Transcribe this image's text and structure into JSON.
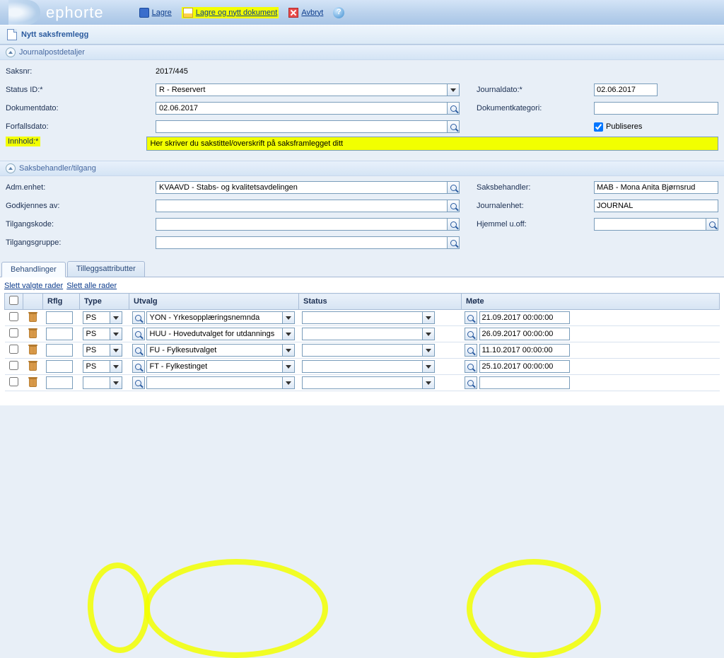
{
  "brand": "ephorte",
  "toolbar": {
    "save": "Lagre",
    "save_new": "Lagre og nytt dokument",
    "cancel": "Avbryt"
  },
  "page_title": "Nytt saksfremlegg",
  "sections": {
    "journal": "Journalpostdetaljer",
    "access": "Saksbehandler/tilgang"
  },
  "labels": {
    "saksnr": "Saksnr:",
    "status_id": "Status ID:*",
    "dokdato": "Dokumentdato:",
    "forfall": "Forfallsdato:",
    "innhold": "Innhold:*",
    "journaldato": "Journaldato:*",
    "dokkat": "Dokumentkategori:",
    "publiseres": "Publiseres",
    "admenhet": "Adm.enhet:",
    "godkjennes": "Godkjennes av:",
    "tilgangskode": "Tilgangskode:",
    "tilgangsgruppe": "Tilgangsgruppe:",
    "saksbehandler": "Saksbehandler:",
    "journalenhet": "Journalenhet:",
    "hjemmel": "Hjemmel u.off:"
  },
  "values": {
    "saksnr": "2017/445",
    "status_id": "R - Reservert",
    "dokdato": "02.06.2017",
    "forfall": "",
    "innhold": "Her skriver du sakstittel/overskrift på saksframlegget ditt",
    "journaldato": "02.06.2017",
    "dokkat": "",
    "publiseres": true,
    "admenhet": "KVAAVD - Stabs- og kvalitetsavdelingen",
    "godkjennes": "",
    "tilgangskode": "",
    "tilgangsgruppe": "",
    "saksbehandler": "MAB - Mona Anita Bjørnsrud",
    "journalenhet": "JOURNAL",
    "hjemmel": ""
  },
  "tabs": {
    "behandlinger": "Behandlinger",
    "tillegg": "Tilleggsattributter"
  },
  "grid": {
    "link_del_sel": "Slett valgte rader",
    "link_del_all": "Slett alle rader",
    "headers": {
      "rflg": "Rflg",
      "type": "Type",
      "utvalg": "Utvalg",
      "status": "Status",
      "mote": "Møte"
    },
    "rows": [
      {
        "type": "PS",
        "utvalg": "YON - Yrkesopplæringsnemnda",
        "status": "",
        "mote": "21.09.2017 00:00:00"
      },
      {
        "type": "PS",
        "utvalg": "HUU - Hovedutvalget for utdannings",
        "status": "",
        "mote": "26.09.2017 00:00:00"
      },
      {
        "type": "PS",
        "utvalg": "FU - Fylkesutvalget",
        "status": "",
        "mote": "11.10.2017 00:00:00"
      },
      {
        "type": "PS",
        "utvalg": "FT - Fylkestinget",
        "status": "",
        "mote": "25.10.2017 00:00:00"
      },
      {
        "type": "",
        "utvalg": "",
        "status": "",
        "mote": ""
      }
    ]
  }
}
